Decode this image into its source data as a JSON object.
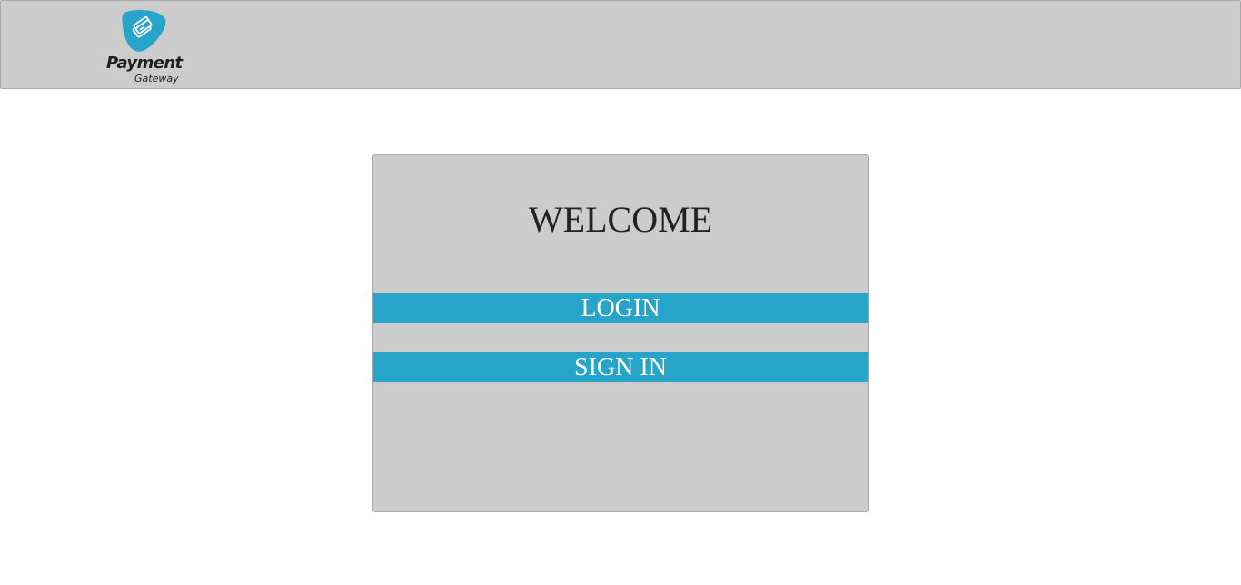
{
  "header": {
    "logo": {
      "icon": "credit-card-tag-icon",
      "brand_color": "#27a4c9",
      "title": "Payment",
      "subtitle": "Gateway"
    }
  },
  "main": {
    "heading": "WELCOME",
    "buttons": {
      "login_label": "LOGIN",
      "signin_label": "SIGN IN"
    }
  },
  "colors": {
    "header_bg": "#cccccc",
    "panel_bg": "#cccccc",
    "button_bg": "#27a4c9",
    "button_text": "#ffffff"
  }
}
